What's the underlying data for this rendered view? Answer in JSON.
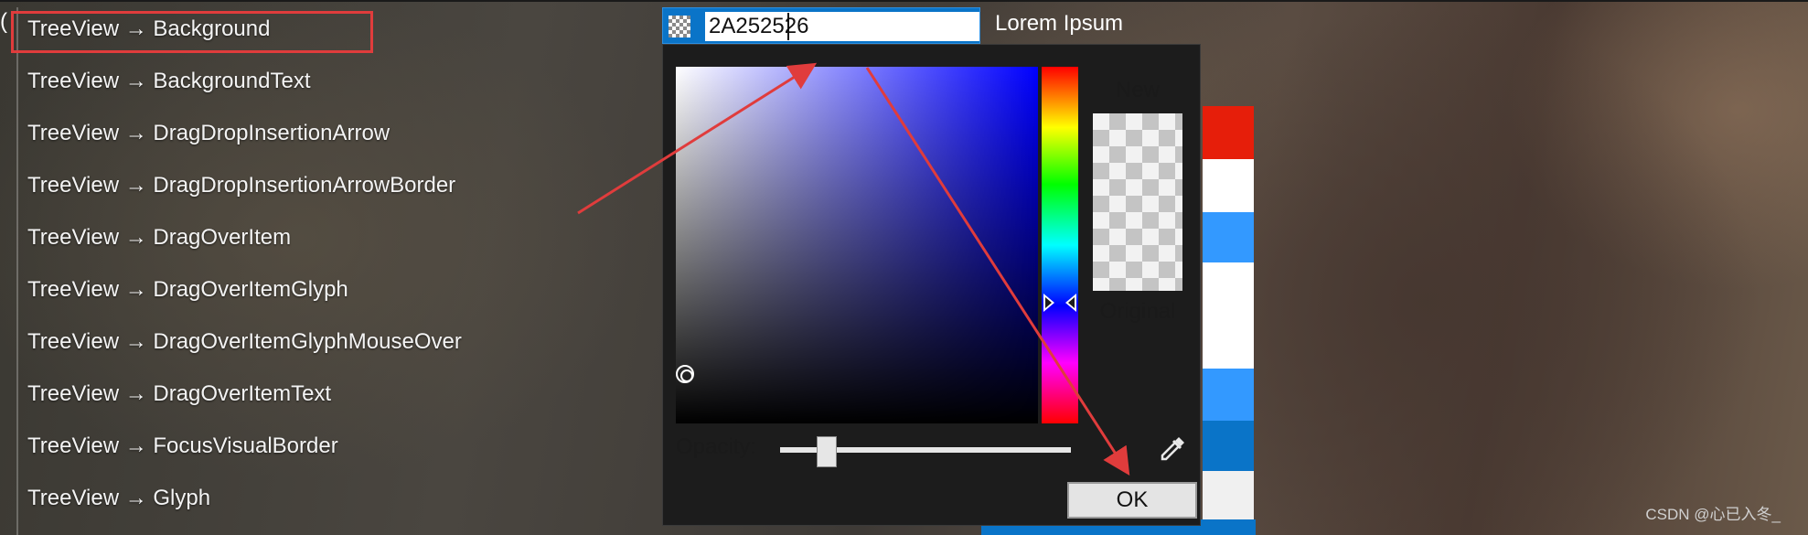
{
  "tree_view": {
    "items": [
      {
        "label": "TreeView → Background"
      },
      {
        "label": "TreeView → BackgroundText"
      },
      {
        "label": "TreeView → DragDropInsertionArrow"
      },
      {
        "label": "TreeView → DragDropInsertionArrowBorder"
      },
      {
        "label": "TreeView → DragOverItem"
      },
      {
        "label": "TreeView → DragOverItemGlyph"
      },
      {
        "label": "TreeView → DragOverItemGlyphMouseOver"
      },
      {
        "label": "TreeView → DragOverItemText"
      },
      {
        "label": "TreeView → FocusVisualBorder"
      },
      {
        "label": "TreeView → Glyph"
      }
    ],
    "selected_index": 0
  },
  "color_editor": {
    "hex_value": "2A252526",
    "sample_text": "Lorem Ipsum"
  },
  "color_picker": {
    "new_label": "New",
    "original_label": "Original",
    "opacity_label": "Opacity:",
    "ok_label": "OK"
  },
  "stripe_colors": [
    "#e61e0a",
    "#ffffff",
    "#3399ff",
    "#ffffff",
    "#ffffff",
    "#3399ff",
    "#0a74c8",
    "#f0f0f0"
  ],
  "annotation_color": "#e03c3c",
  "watermark": "CSDN @心已入冬_"
}
